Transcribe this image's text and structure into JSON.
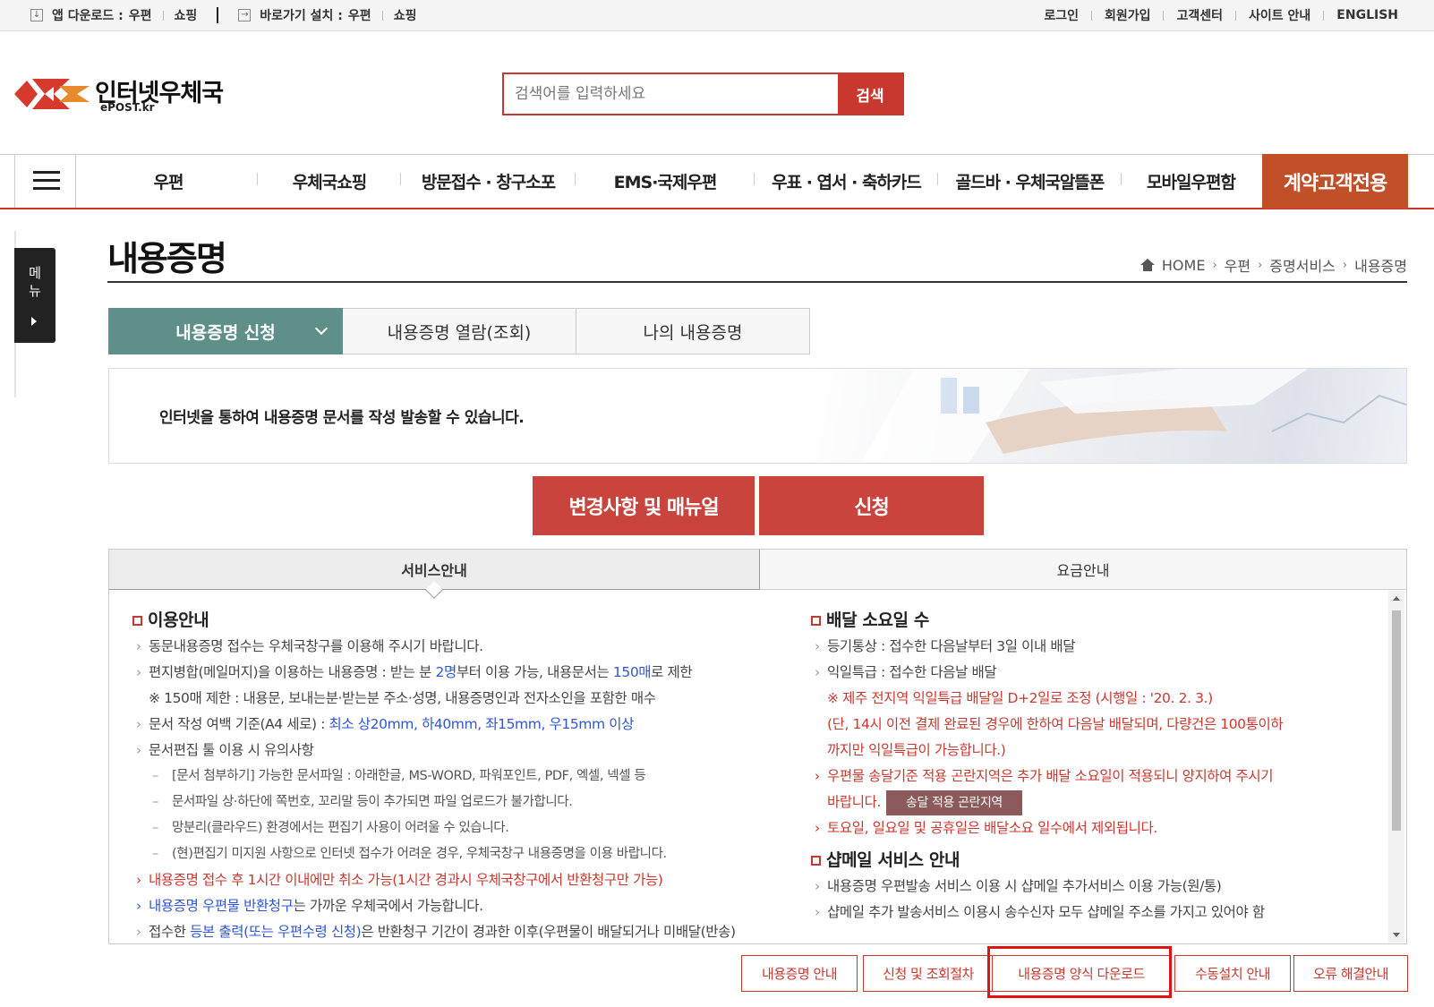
{
  "topbar": {
    "app_download_label": "앱 다운로드 :",
    "app_links": [
      "우편",
      "쇼핑"
    ],
    "shortcut_label": "바로가기 설치 :",
    "shortcut_links": [
      "우편",
      "쇼핑"
    ],
    "right_links": [
      "로그인",
      "회원가입",
      "고객센터",
      "사이트 안내",
      "ENGLISH"
    ]
  },
  "logo": {
    "title": "인터넷우체국",
    "sub": "ePOST.kr"
  },
  "search": {
    "placeholder": "검색어를 입력하세요",
    "button": "검색"
  },
  "gnb": {
    "items": [
      "우편",
      "우체국쇼핑",
      "방문접수 · 창구소포",
      "EMS·국제우편",
      "우표 · 엽서 · 축하카드",
      "골드바 · 우체국알뜰폰",
      "모바일우편함"
    ],
    "special": "계약고객전용"
  },
  "side_menu": {
    "label": "메뉴"
  },
  "page": {
    "title": "내용증명",
    "breadcrumb": [
      "HOME",
      "우편",
      "증명서비스",
      "내용증명"
    ]
  },
  "subtabs": [
    "내용증명 신청",
    "내용증명 열람(조회)",
    "나의 내용증명"
  ],
  "banner": {
    "text": "인터넷을 통하여 내용증명 문서를 작성 발송할 수 있습니다."
  },
  "actions": {
    "manual": "변경사항 및 매뉴얼",
    "apply": "신청"
  },
  "info_tabs": [
    "서비스안내",
    "요금안내"
  ],
  "usage": {
    "heading": "이용안내",
    "l1": "동문내용증명 접수는 우체국창구를 이용해 주시기 바랍니다.",
    "l2a": "편지병합(메일머지)을 이용하는 내용증명 : 받는 분 ",
    "l2b": "2명",
    "l2c": "부터 이용 가능, 내용문서는 ",
    "l2d": "150매",
    "l2e": "로 제한",
    "l3": "※ 150매 제한 : 내용문, 보내는분·받는분 주소·성명, 내용증명인과 전자소인을 포함한 매수",
    "l4a": "문서 작성 여백 기준(A4 세로) : ",
    "l4b": "최소 상20mm, 하40mm, 좌15mm, 우15mm 이상",
    "l5": "문서편집 툴 이용 시 유의사항",
    "d1": "[문서 첨부하기] 가능한 문서파일 : 아래한글, MS-WORD, 파워포인트, PDF, 엑셀, 넥셀 등",
    "d2": "문서파일 상·하단에 쪽번호, 꼬리말 등이 추가되면 파일 업로드가 불가합니다.",
    "d3": "망분리(클라우드) 환경에서는 편집기 사용이 어려울 수 있습니다.",
    "d4": "(현)편집기 미지원 사항으로 인터넷 접수가 어려운 경우, 우체국창구 내용증명을 이용 바랍니다.",
    "l6": "내용증명 접수 후 1시간 이내에만 취소 가능(1시간 경과시 우체국창구에서 반환청구만 가능)",
    "l7a": "내용증명 우편물 반환청구",
    "l7b": "는 가까운 우체국에서 가능합니다.",
    "l8a": "접수한 ",
    "l8b": "등본 출력(또는 우편수령 신청)",
    "l8c": "은 반환청구 기간이 경과한 이후(우편물이 배달되거나 미배달(반송)"
  },
  "delivery": {
    "heading": "배달 소요일 수",
    "l1": "등기통상 : 접수한 다음날부터 3일 이내 배달",
    "l2": "익일특급 : 접수한 다음날 배달",
    "n1": "※ 제주 전지역 익일특급 배달일 D+2일로 조정 (시행일 : '20. 2. 3.)",
    "n2": "(단, 14시 이전 결제 완료된 경우에 한하여 다음날 배달되며, 다량건은 100통이하",
    "n3": "까지만 익일특급이 가능합니다.)",
    "l3": "우편물 송달기준 적용 곤란지역은 추가 배달 소요일이 적용되니 양지하여 주시기",
    "l3b": "바랍니다.",
    "area_button": "송달 적용 곤란지역",
    "l4": "토요일, 일요일 및 공휴일은 배달소요 일수에서 제외됩니다."
  },
  "shopmail": {
    "heading": "샵메일 서비스 안내",
    "l1": "내용증명 우편발송 서비스 이용 시 샵메일 추가서비스 이용 가능(원/통)",
    "l2": "샵메일 추가 발송서비스 이용시 송수신자 모두 샵메일 주소를 가지고 있어야 함"
  },
  "bottom_buttons": [
    "내용증명 안내",
    "신청 및 조회절차",
    "내용증명 양식 다운로드",
    "수동설치 안내",
    "오류 해결안내"
  ],
  "colors": {
    "brand_red": "#c9382f",
    "teal": "#5e8f89",
    "special_orange": "#c14f28",
    "highlight": "#e11212"
  }
}
